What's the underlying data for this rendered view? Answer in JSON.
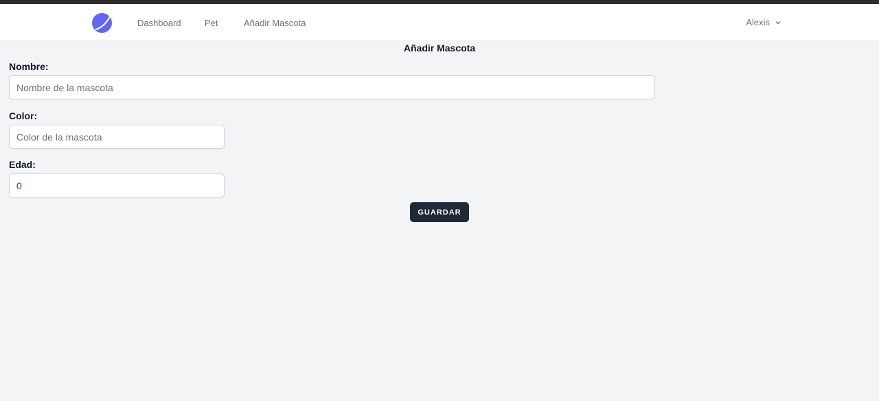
{
  "nav": {
    "logo": "app-logo",
    "links": [
      {
        "label": "Dashboard"
      },
      {
        "label": "Pet"
      },
      {
        "label": "Añadir Mascota"
      }
    ],
    "user": {
      "name": "Alexis"
    }
  },
  "form": {
    "title": "Añadir Mascota",
    "nombre": {
      "label": "Nombre:",
      "placeholder": "Nombre de la mascota",
      "value": ""
    },
    "color": {
      "label": "Color:",
      "placeholder": "Color de la mascota",
      "value": ""
    },
    "edad": {
      "label": "Edad:",
      "placeholder": "",
      "value": "0"
    },
    "submit_label": "GUARDAR"
  },
  "colors": {
    "accent": "#6366f1",
    "button": "#1f2937",
    "background": "#f3f4f6"
  }
}
